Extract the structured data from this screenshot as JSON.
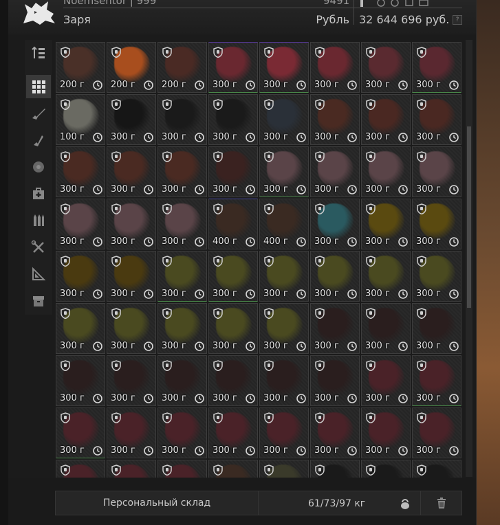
{
  "header": {
    "top_left_partial": "Noemsentor | 999",
    "top_right_partial": "9491",
    "trader_name": "Заря",
    "currency_label": "Рубль",
    "balance": "32 644 696 руб.",
    "help": "?"
  },
  "sidebar": {
    "items": [
      {
        "icon": "sort-icon",
        "active": false
      },
      {
        "icon": "grid-all-icon",
        "active": true
      },
      {
        "icon": "rifle-icon",
        "active": false
      },
      {
        "icon": "weapon-parts-icon",
        "active": false
      },
      {
        "icon": "ammo-box-icon",
        "active": false
      },
      {
        "icon": "medkit-icon",
        "active": false
      },
      {
        "icon": "ammo-icon",
        "active": false
      },
      {
        "icon": "tools-icon",
        "active": false
      },
      {
        "icon": "map-icon",
        "active": false
      },
      {
        "icon": "container-icon",
        "active": false
      }
    ]
  },
  "grid": {
    "rows": [
      [
        {
          "weight": "200 г",
          "color": "#4a3028",
          "border": ""
        },
        {
          "weight": "200 г",
          "color": "#a84e1e",
          "border": ""
        },
        {
          "weight": "200 г",
          "color": "#4a2a24",
          "border": ""
        },
        {
          "weight": "300 г",
          "color": "#6a2830",
          "border": "green-blue"
        },
        {
          "weight": "300 г",
          "color": "#7a2a34",
          "border": "green-blue"
        },
        {
          "weight": "300 г",
          "color": "#6a2830",
          "border": ""
        },
        {
          "weight": "300 г",
          "color": "#5a2a30",
          "border": ""
        },
        {
          "weight": "300 г",
          "color": "#5a2830",
          "border": "green"
        }
      ],
      [
        {
          "weight": "100 г",
          "color": "#6a6a62",
          "border": ""
        },
        {
          "weight": "300 г",
          "color": "#161616",
          "border": ""
        },
        {
          "weight": "300 г",
          "color": "#1a1a1a",
          "border": ""
        },
        {
          "weight": "300 г",
          "color": "#1a1a1a",
          "border": ""
        },
        {
          "weight": "300 г",
          "color": "#2a3038",
          "border": ""
        },
        {
          "weight": "300 г",
          "color": "#4a2a22",
          "border": ""
        },
        {
          "weight": "300 г",
          "color": "#4a2822",
          "border": ""
        },
        {
          "weight": "300 г",
          "color": "#4a2822",
          "border": ""
        }
      ],
      [
        {
          "weight": "300 г",
          "color": "#4a2a22",
          "border": ""
        },
        {
          "weight": "300 г",
          "color": "#4a2a22",
          "border": ""
        },
        {
          "weight": "300 г",
          "color": "#4a2a22",
          "border": ""
        },
        {
          "weight": "300 г",
          "color": "#3a2220",
          "border": ""
        },
        {
          "weight": "300 г",
          "color": "#5a4448",
          "border": "green"
        },
        {
          "weight": "300 г",
          "color": "#5a4448",
          "border": ""
        },
        {
          "weight": "300 г",
          "color": "#5a4448",
          "border": ""
        },
        {
          "weight": "300 г",
          "color": "#5a4448",
          "border": ""
        }
      ],
      [
        {
          "weight": "300 г",
          "color": "#5a4448",
          "border": ""
        },
        {
          "weight": "300 г",
          "color": "#5a4448",
          "border": ""
        },
        {
          "weight": "300 г",
          "color": "#5a4448",
          "border": ""
        },
        {
          "weight": "400 г",
          "color": "#3a2a22",
          "border": "blue"
        },
        {
          "weight": "400 г",
          "color": "#3a2a22",
          "border": ""
        },
        {
          "weight": "300 г",
          "color": "#2a5a60",
          "border": ""
        },
        {
          "weight": "300 г",
          "color": "#5a4a10",
          "border": ""
        },
        {
          "weight": "300 г",
          "color": "#5a4a10",
          "border": ""
        }
      ],
      [
        {
          "weight": "300 г",
          "color": "#4a3a10",
          "border": ""
        },
        {
          "weight": "300 г",
          "color": "#4a3a10",
          "border": ""
        },
        {
          "weight": "300 г",
          "color": "#4a4a20",
          "border": "green"
        },
        {
          "weight": "300 г",
          "color": "#4a4a20",
          "border": "green"
        },
        {
          "weight": "300 г",
          "color": "#4a4a20",
          "border": ""
        },
        {
          "weight": "300 г",
          "color": "#4a4a20",
          "border": ""
        },
        {
          "weight": "300 г",
          "color": "#4a4a20",
          "border": ""
        },
        {
          "weight": "300 г",
          "color": "#4a4a20",
          "border": ""
        }
      ],
      [
        {
          "weight": "300 г",
          "color": "#4a4a20",
          "border": ""
        },
        {
          "weight": "300 г",
          "color": "#4a4a20",
          "border": ""
        },
        {
          "weight": "300 г",
          "color": "#4a4a20",
          "border": ""
        },
        {
          "weight": "300 г",
          "color": "#4a4a20",
          "border": ""
        },
        {
          "weight": "300 г",
          "color": "#4a4a20",
          "border": ""
        },
        {
          "weight": "300 г",
          "color": "#2a1e1e",
          "border": ""
        },
        {
          "weight": "300 г",
          "color": "#2a1e1e",
          "border": ""
        },
        {
          "weight": "300 г",
          "color": "#2a1e1e",
          "border": ""
        }
      ],
      [
        {
          "weight": "300 г",
          "color": "#2a1e1e",
          "border": ""
        },
        {
          "weight": "300 г",
          "color": "#2a1e1e",
          "border": ""
        },
        {
          "weight": "300 г",
          "color": "#2a1e1e",
          "border": ""
        },
        {
          "weight": "300 г",
          "color": "#2a1e1e",
          "border": ""
        },
        {
          "weight": "300 г",
          "color": "#2a1e1e",
          "border": ""
        },
        {
          "weight": "300 г",
          "color": "#2a1e1e",
          "border": ""
        },
        {
          "weight": "300 г",
          "color": "#4a2228",
          "border": ""
        },
        {
          "weight": "300 г",
          "color": "#4a2228",
          "border": "green"
        }
      ],
      [
        {
          "weight": "300 г",
          "color": "#4a2228",
          "border": "green"
        },
        {
          "weight": "300 г",
          "color": "#4a2228",
          "border": ""
        },
        {
          "weight": "300 г",
          "color": "#4a2228",
          "border": ""
        },
        {
          "weight": "300 г",
          "color": "#4a2228",
          "border": ""
        },
        {
          "weight": "300 г",
          "color": "#4a2228",
          "border": ""
        },
        {
          "weight": "300 г",
          "color": "#4a2228",
          "border": ""
        },
        {
          "weight": "300 г",
          "color": "#4a2228",
          "border": ""
        },
        {
          "weight": "300 г",
          "color": "#4a2228",
          "border": ""
        }
      ],
      [
        {
          "weight": "",
          "color": "#4a2228",
          "border": ""
        },
        {
          "weight": "",
          "color": "#4a2228",
          "border": ""
        },
        {
          "weight": "",
          "color": "#4a2228",
          "border": ""
        },
        {
          "weight": "",
          "color": "#3a2a22",
          "border": ""
        },
        {
          "weight": "",
          "color": "#3a3a2a",
          "border": ""
        },
        {
          "weight": "",
          "color": "#1a1a1a",
          "border": "green"
        },
        {
          "weight": "",
          "color": "#1a1a1a",
          "border": ""
        },
        {
          "weight": "",
          "color": "#1a1a1a",
          "border": ""
        }
      ]
    ]
  },
  "footer": {
    "stash_label": "Персональный склад",
    "weight_total": "61/73/97 кг"
  },
  "colors": {
    "accent_green": "#4a8a4a",
    "accent_blue": "#4a4aa0",
    "text": "#c8c8c8"
  }
}
